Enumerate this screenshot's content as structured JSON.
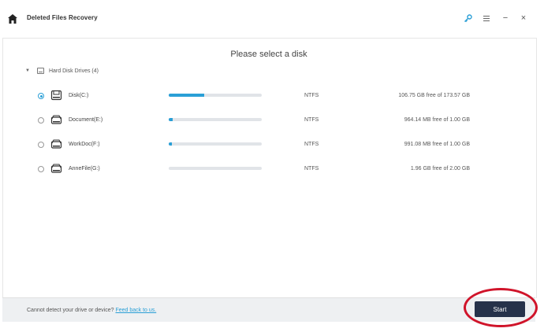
{
  "window": {
    "title": "Deleted Files Recovery",
    "icons": {
      "home": "home-icon",
      "key": "key-icon",
      "menu": "menu-icon",
      "minimize": "minimize-icon",
      "close": "close-icon"
    },
    "minimize_glyph": "−",
    "close_glyph": "×"
  },
  "main": {
    "heading": "Please select a disk",
    "group": {
      "label": "Hard Disk Drives (4)"
    },
    "drives": [
      {
        "name": "Disk(C:)",
        "fs": "NTFS",
        "free": "106.75 GB  free of  173.57 GB",
        "used_fraction": 0.38,
        "selected": true
      },
      {
        "name": "Document(E:)",
        "fs": "NTFS",
        "free": "964.14 MB  free of  1.00 GB",
        "used_fraction": 0.04,
        "selected": false
      },
      {
        "name": "WorkDoc(F:)",
        "fs": "NTFS",
        "free": "991.08 MB  free of  1.00 GB",
        "used_fraction": 0.03,
        "selected": false
      },
      {
        "name": "AnneFile(G:)",
        "fs": "NTFS",
        "free": "1.96 GB  free of  2.00 GB",
        "used_fraction": 0.0,
        "selected": false
      }
    ]
  },
  "footer": {
    "hint": "Cannot detect your drive or device?",
    "link": "Feed back to us.",
    "start_label": "Start"
  },
  "colors": {
    "accent": "#2a9fd6",
    "start_button": "#26324a",
    "annotation_circle": "#d0142a"
  }
}
